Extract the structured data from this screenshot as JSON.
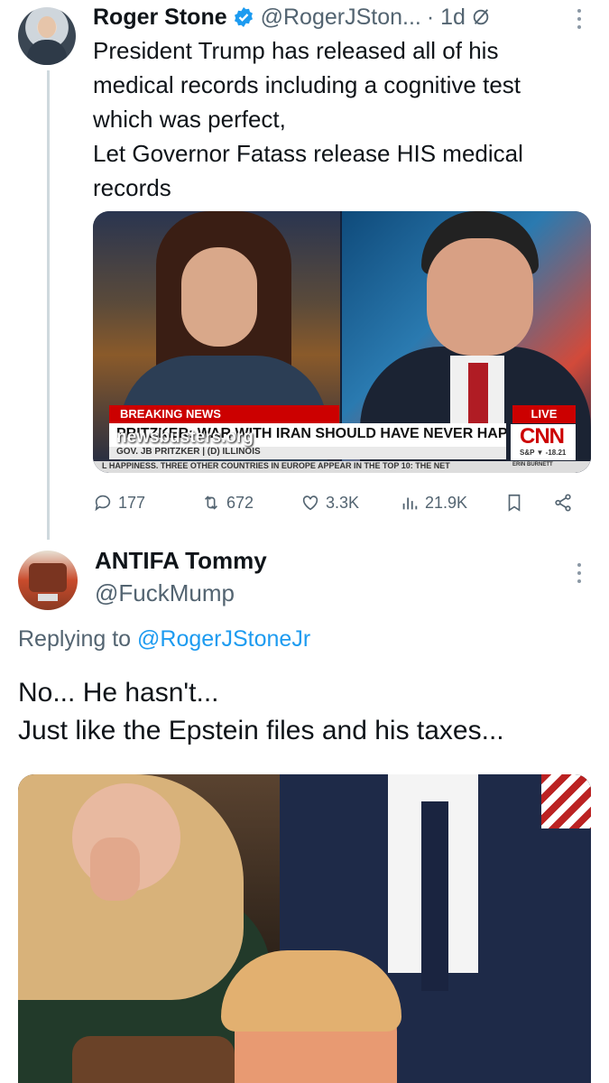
{
  "tweet1": {
    "name": "Roger Stone",
    "handle": "@RogerJSton...",
    "time": "· 1d",
    "text_lines": [
      "President Trump has released all of his",
      "medical records including a cognitive test",
      "which was perfect,",
      "Let Governor Fatass release HIS medical",
      "records"
    ],
    "media": {
      "breaking": "BREAKING NEWS",
      "live": "LIVE",
      "headline": "PRITZKER: WAR WITH IRAN SHOULD HAVE NEVER HAPPENED",
      "subline": "GOV. JB PRITZKER  |  (D) ILLINOIS",
      "ticker": "L HAPPINESS. THREE OTHER COUNTRIES IN EUROPE APPEAR IN THE TOP 10: THE NET",
      "watermark": "newsbusters.org",
      "network": "CNN",
      "market": "S&P ▼ -18.21",
      "show": "ERIN BURNETT"
    },
    "actions": {
      "replies": "177",
      "reposts": "672",
      "likes": "3.3K",
      "views": "21.9K"
    }
  },
  "tweet2": {
    "name": "ANTIFA Tommy",
    "handle": "@FuckMump",
    "replying_prefix": "Replying to",
    "replying_to": "@RogerJStoneJr",
    "text_lines": [
      "No... He hasn't...",
      "Just like the Epstein files and his taxes..."
    ]
  },
  "colors": {
    "text": "#0f1419",
    "muted": "#536471",
    "link": "#1d9bf0",
    "verified": "#1d9bf0",
    "thread_line": "#cfd9de"
  },
  "icons": [
    "verified-badge-icon",
    "no-reply-icon",
    "more-icon",
    "reply-icon",
    "repost-icon",
    "like-icon",
    "views-icon",
    "bookmark-icon",
    "share-icon"
  ]
}
